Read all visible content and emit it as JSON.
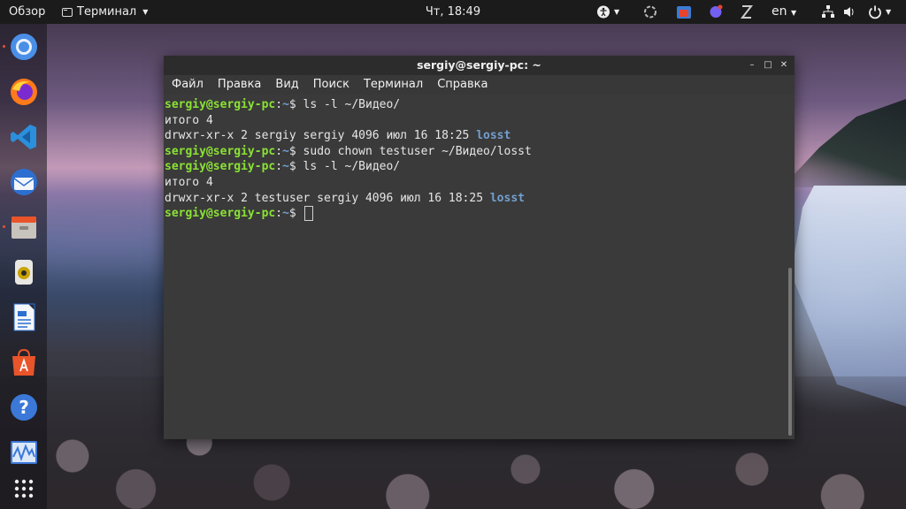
{
  "topbar": {
    "overview": "Обзор",
    "app_name": "Терминал",
    "clock": "Чт, 18:49",
    "lang": "en"
  },
  "dock": {
    "items": [
      "chromium-icon",
      "firefox-icon",
      "vscode-icon",
      "thunderbird-icon",
      "files-icon",
      "rhythmbox-icon",
      "writer-icon",
      "software-icon",
      "help-icon",
      "system-monitor-icon",
      "show-apps-icon"
    ]
  },
  "terminal": {
    "title": "sergiy@sergiy-pc: ~",
    "menu": [
      "Файл",
      "Правка",
      "Вид",
      "Поиск",
      "Терминал",
      "Справка"
    ],
    "prompt_user": "sergiy@sergiy-pc",
    "prompt_sep": ":",
    "prompt_path": "~",
    "prompt_sym": "$ ",
    "lines": [
      {
        "kind": "cmd",
        "text": "ls -l ~/Видео/"
      },
      {
        "kind": "out",
        "text": "итого 4"
      },
      {
        "kind": "ls",
        "text": "drwxr-xr-x 2 sergiy sergiy 4096 июл 16 18:25 ",
        "dir": "losst"
      },
      {
        "kind": "cmd",
        "text": "sudo chown testuser ~/Видео/losst"
      },
      {
        "kind": "cmd",
        "text": "ls -l ~/Видео/"
      },
      {
        "kind": "out",
        "text": "итого 4"
      },
      {
        "kind": "ls",
        "text": "drwxr-xr-x 2 testuser sergiy 4096 июл 16 18:25 ",
        "dir": "losst"
      },
      {
        "kind": "prompt",
        "text": ""
      }
    ]
  },
  "colors": {
    "prompt_user": "#8ae234",
    "prompt_path": "#729fcf",
    "terminal_bg": "#3a3a3a"
  }
}
